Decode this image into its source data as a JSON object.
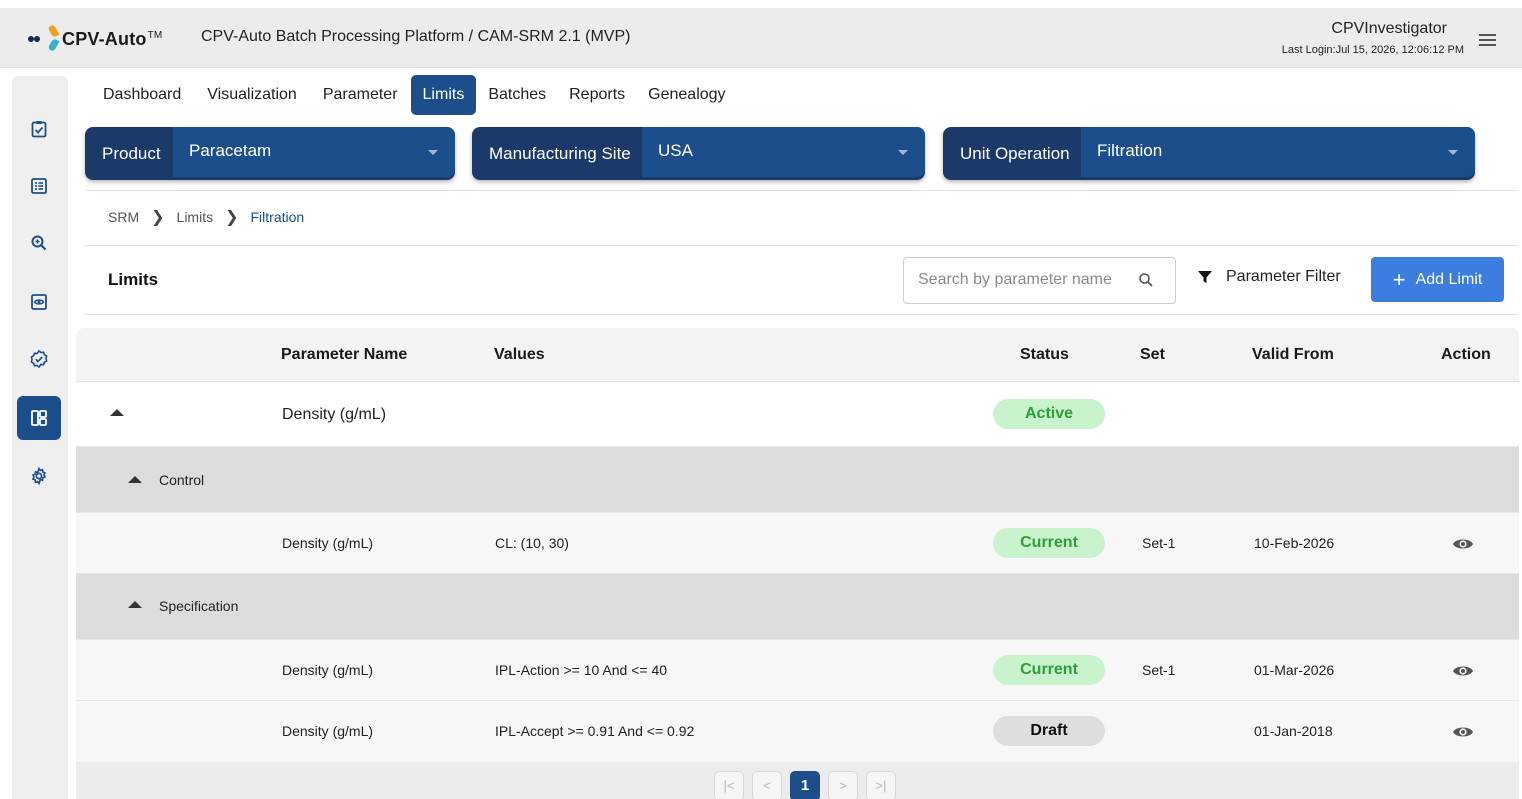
{
  "header": {
    "logo_text": "CPV-Auto",
    "logo_tm": "TM",
    "app_title": "CPV-Auto Batch Processing Platform / CAM-SRM 2.1 (MVP)",
    "user_name": "CPVInvestigator",
    "last_login": "Last Login:Jul 15, 2026, 12:06:12 PM"
  },
  "sidebar": {
    "items": [
      {
        "icon": "clipboard-check-icon"
      },
      {
        "icon": "list-icon"
      },
      {
        "icon": "zoom-icon"
      },
      {
        "icon": "eye-screen-icon"
      },
      {
        "icon": "badge-check-icon"
      },
      {
        "icon": "dashboard-icon",
        "active": true
      },
      {
        "icon": "gear-icon"
      }
    ]
  },
  "tabs": [
    "Dashboard",
    "Visualization",
    "Parameter",
    "Limits",
    "Batches",
    "Reports",
    "Genealogy"
  ],
  "active_tab": "Limits",
  "selectors": {
    "product": {
      "label": "Product",
      "value": "Paracetam"
    },
    "site": {
      "label": "Manufacturing Site",
      "value": "USA"
    },
    "unit_operation": {
      "label": "Unit Operation",
      "value": "Filtration"
    }
  },
  "breadcrumb": [
    "SRM",
    "Limits",
    "Filtration"
  ],
  "limits": {
    "title": "Limits",
    "search_placeholder": "Search by parameter name",
    "filter_label": "Parameter Filter",
    "add_label": "Add Limit"
  },
  "table": {
    "columns": [
      "Parameter Name",
      "Values",
      "Status",
      "Set",
      "Valid From",
      "Action"
    ],
    "parent": {
      "name": "Density (g/mL)",
      "status": "Active"
    },
    "groups": [
      {
        "name": "Control",
        "rows": [
          {
            "name": "Density (g/mL)",
            "value": "CL: (10, 30)",
            "status": "Current",
            "set": "Set-1",
            "valid_from": "10-Feb-2026"
          }
        ]
      },
      {
        "name": "Specification",
        "rows": [
          {
            "name": "Density (g/mL)",
            "value": "IPL-Action >= 10 And <= 40",
            "status": "Current",
            "set": "Set-1",
            "valid_from": "01-Mar-2026"
          },
          {
            "name": "Density (g/mL)",
            "value": "IPL-Accept >= 0.91 And <= 0.92",
            "status": "Draft",
            "set": "",
            "valid_from": "01-Jan-2018"
          }
        ]
      }
    ]
  },
  "pagination": {
    "first": "|<",
    "prev": "<",
    "current": "1",
    "next": ">",
    "last": ">|"
  },
  "colors": {
    "primary": "#1d4e8c",
    "selector_bg": "#1b3a6a",
    "button": "#3b7ee0",
    "status_green": "#2e9e3a",
    "status_green_bg": "#c9f3cd"
  }
}
